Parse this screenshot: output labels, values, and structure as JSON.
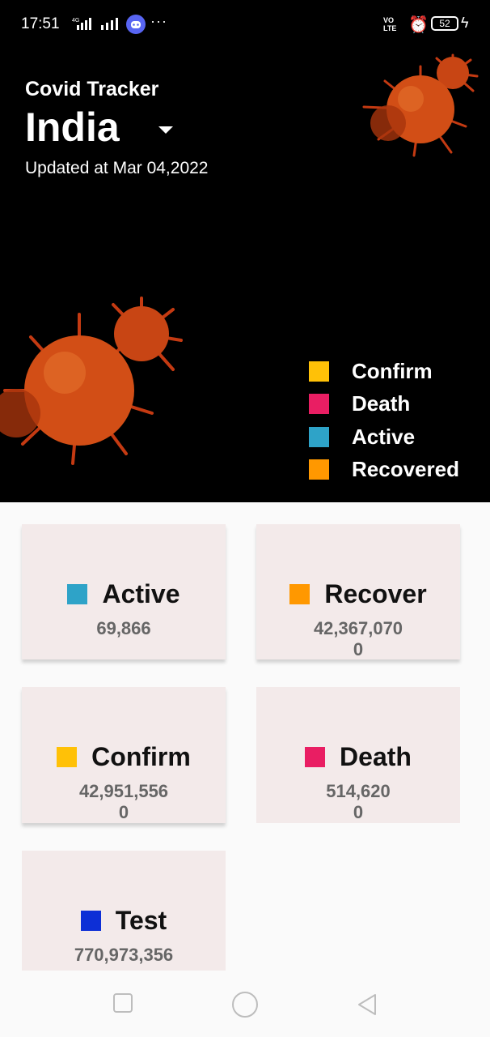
{
  "status_bar": {
    "time": "17:51",
    "network": "4G",
    "volte": [
      "VO",
      "LTE"
    ],
    "battery": "52"
  },
  "header": {
    "app_title": "Covid Tracker",
    "country": "India",
    "updated": "Updated at Mar 04,2022"
  },
  "legend": [
    {
      "label": "Confirm",
      "color": "#ffc107"
    },
    {
      "label": "Death",
      "color": "#e91e63"
    },
    {
      "label": "Active",
      "color": "#2ea3c8"
    },
    {
      "label": "Recovered",
      "color": "#ff9800"
    }
  ],
  "cards": {
    "active": {
      "label": "Active",
      "value": "69,866",
      "color": "#2ea3c8"
    },
    "recover": {
      "label": "Recover",
      "value": "42,367,070\n0",
      "color": "#ff9800"
    },
    "confirm": {
      "label": "Confirm",
      "value": "42,951,556\n0",
      "color": "#ffc107"
    },
    "death": {
      "label": "Death",
      "value": "514,620\n0",
      "color": "#e91e63"
    },
    "test": {
      "label": "Test",
      "value": "770,973,356",
      "color": "#0d2fd6"
    }
  },
  "icons": [
    "discord-icon",
    "alarm-icon",
    "battery-icon",
    "charging-icon",
    "dropdown-caret-icon",
    "virus-icon",
    "square-nav-icon",
    "circle-nav-icon",
    "back-nav-icon"
  ]
}
